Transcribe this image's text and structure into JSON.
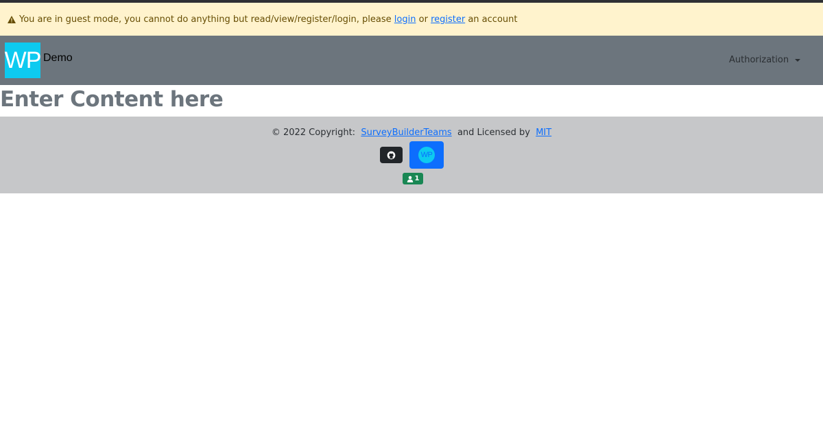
{
  "alert": {
    "text_before": "You are in guest mode, you cannot do anything but read/view/register/login, please",
    "login_link": "login",
    "text_or": "or",
    "register_link": "register",
    "text_after": "an account",
    "icon": "warning-triangle-icon"
  },
  "navbar": {
    "logo_text": "WP",
    "brand_name": "Demo",
    "auth_menu": "Authorization"
  },
  "main": {
    "heading": "Enter Content here"
  },
  "footer": {
    "copyright_prefix": "© 2022 Copyright:",
    "team_link": "SurveyBuilderTeams",
    "licensed_text": "and Licensed by",
    "license_link": "MIT",
    "github_icon": "github-icon",
    "wp_logo_text": "WP",
    "user_count": "1"
  },
  "colors": {
    "alert_bg": "#fff3cd",
    "navbar_bg": "#6c757d",
    "logo_bg": "#0dcaf0",
    "footer_bg": "#c6c7c9",
    "link": "#0d6efd",
    "badge_green": "#198754"
  }
}
